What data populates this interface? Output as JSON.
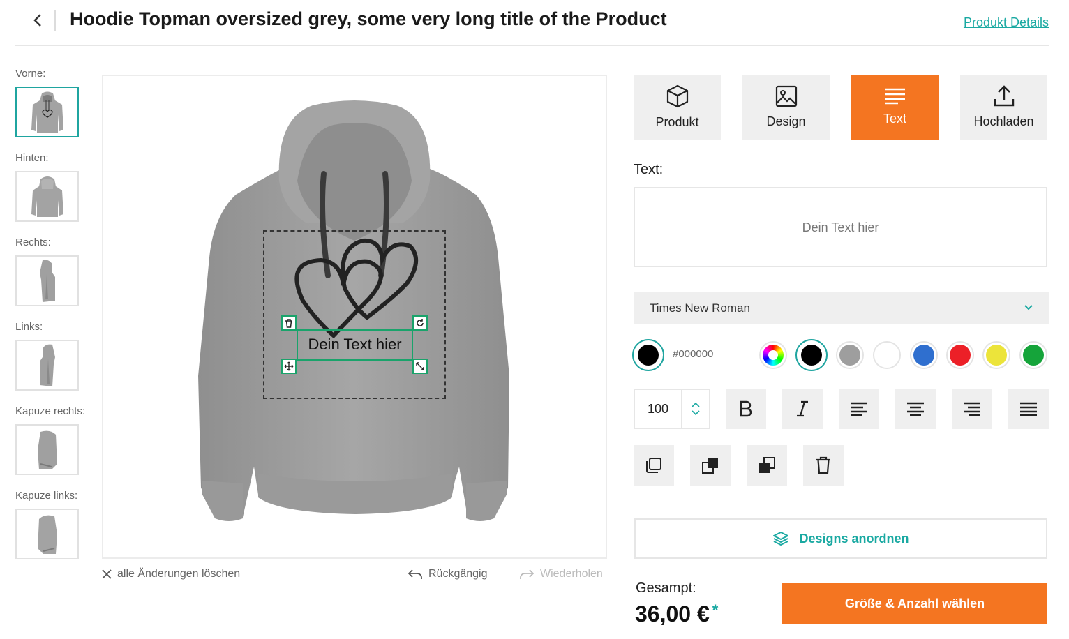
{
  "header": {
    "back_icon": "chevron-left-icon",
    "title": "Hoodie Topman oversized grey, some very long title of the Product",
    "details_link": "Produkt Details"
  },
  "views": [
    {
      "label": "Vorne:",
      "active": true
    },
    {
      "label": "Hinten:",
      "active": false
    },
    {
      "label": "Rechts:",
      "active": false
    },
    {
      "label": "Links:",
      "active": false
    },
    {
      "label": "Kapuze rechts:",
      "active": false
    },
    {
      "label": "Kapuze links:",
      "active": false
    }
  ],
  "canvas": {
    "product_color": "#9c9c9c",
    "text_element": "Dein Text hier",
    "accent_color": "#1aa36b"
  },
  "canvas_actions": {
    "clear_all": "alle Änderungen löschen",
    "undo": "Rückgängig",
    "redo": "Wiederholen"
  },
  "tabs": [
    {
      "label": "Produkt",
      "icon": "cube-icon",
      "active": false
    },
    {
      "label": "Design",
      "icon": "image-icon",
      "active": false
    },
    {
      "label": "Text",
      "icon": "text-lines-icon",
      "active": true
    },
    {
      "label": "Hochladen",
      "icon": "upload-icon",
      "active": false
    }
  ],
  "text_panel": {
    "label": "Text:",
    "placeholder": "Dein Text hier",
    "font": "Times New Roman",
    "current_color_hex": "#000000",
    "palette": [
      "rainbow",
      "#000000",
      "#9e9e9e",
      "#ffffff",
      "#2f6fcf",
      "#ec2027",
      "#ece43a",
      "#15a43a"
    ],
    "selected_swatch": "#000000",
    "font_size": "100"
  },
  "arrange_button": "Designs anordnen",
  "total": {
    "label": "Gesampt:",
    "price": "36,00 €",
    "asterisk": "*"
  },
  "cta": "Größe & Anzahl wählen",
  "colors": {
    "accent_orange": "#f47521",
    "accent_teal": "#1aa9a2"
  }
}
